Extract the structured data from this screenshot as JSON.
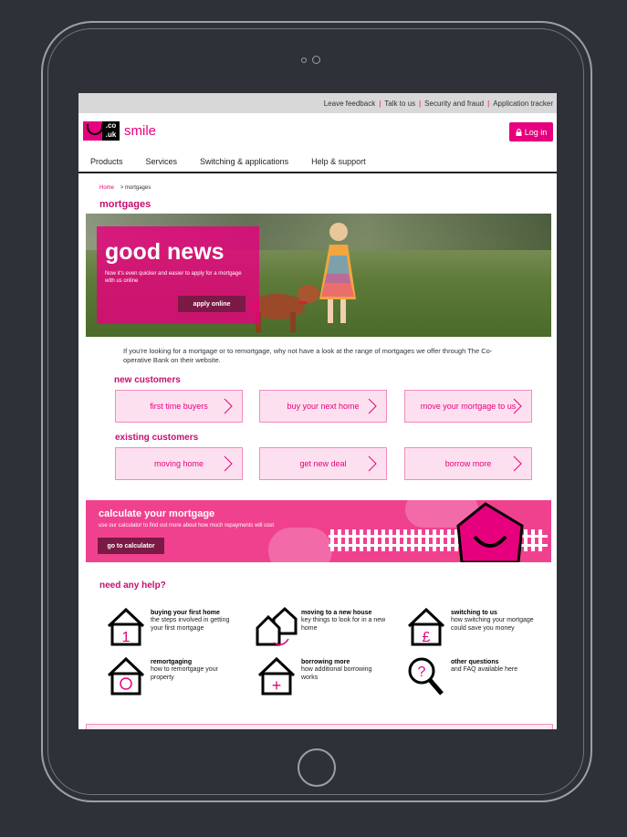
{
  "utility": {
    "links": [
      "Leave feedback",
      "Talk to us",
      "Security and fraud",
      "Application tracker"
    ]
  },
  "header": {
    "logo_co": ".co",
    "logo_uk": ".uk",
    "logo_text": "smile",
    "login_label": "Log in"
  },
  "nav": {
    "items": [
      "Products",
      "Services",
      "Switching & applications",
      "Help & support"
    ]
  },
  "breadcrumb": {
    "home": "Home",
    "current": "> mortgages"
  },
  "page": {
    "title": "mortgages"
  },
  "hero": {
    "headline": "good news",
    "text": "Now it's even quicker and easier to apply for a mortgage with us online",
    "button": "apply online"
  },
  "intro": "If you're looking for a mortgage or to remortgage, why not have a look at the range of mortgages we offer through The Co-operative Bank on their website.",
  "new_customers": {
    "heading": "new customers",
    "tiles": [
      "first time buyers",
      "buy your next home",
      "move your mortgage to us"
    ]
  },
  "existing_customers": {
    "heading": "existing customers",
    "tiles": [
      "moving home",
      "get new deal",
      "borrow more"
    ]
  },
  "calculator": {
    "heading": "calculate your mortgage",
    "text": "use our calculator to find out more about how much repayments will cost",
    "button": "go to calculator"
  },
  "help": {
    "heading": "need any help?",
    "items": [
      {
        "title": "buying your first home",
        "desc": "the steps involved in getting your first mortgage",
        "icon": "house-one-icon"
      },
      {
        "title": "moving to a new house",
        "desc": "key things to look for in a new home",
        "icon": "two-houses-icon"
      },
      {
        "title": "switching to us",
        "desc": "how switching your mortgage could save you money",
        "icon": "house-pound-icon"
      },
      {
        "title": "remortgaging",
        "desc": "how to remortgage your property",
        "icon": "house-refresh-icon"
      },
      {
        "title": "borrowing more",
        "desc": "how additional borrowing works",
        "icon": "house-plus-icon"
      },
      {
        "title": "other questions",
        "desc": "and FAQ available here",
        "icon": "magnifier-question-icon"
      }
    ]
  },
  "colors": {
    "brand": "#e6007e",
    "heading": "#c4106e",
    "button_dark": "#7a1a45",
    "calc_bg": "#f0418f"
  }
}
